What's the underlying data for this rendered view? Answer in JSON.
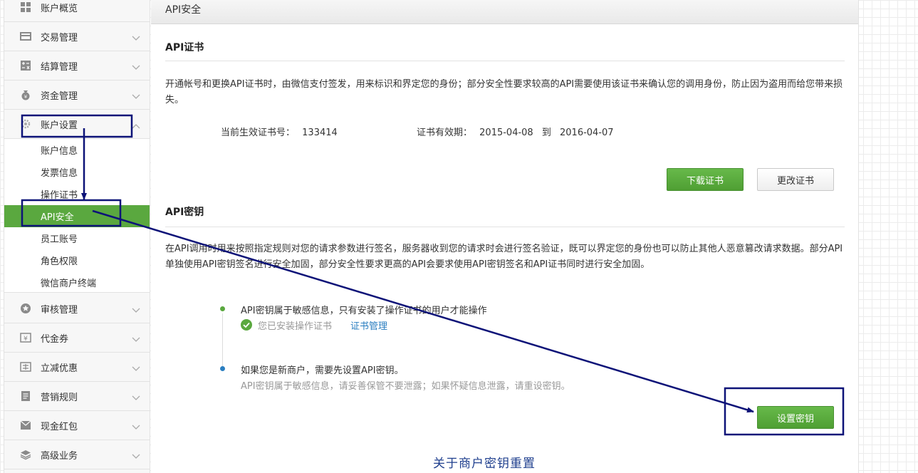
{
  "sidebar": {
    "items": [
      {
        "label": "账户概览",
        "icon": "grid-icon"
      },
      {
        "label": "交易管理",
        "icon": "card-icon"
      },
      {
        "label": "结算管理",
        "icon": "calculator-icon"
      },
      {
        "label": "资金管理",
        "icon": "money-bag-icon"
      },
      {
        "label": "账户设置",
        "icon": "gear-icon"
      },
      {
        "label": "审核管理",
        "icon": "star-badge-icon"
      },
      {
        "label": "代金券",
        "icon": "yen-icon"
      },
      {
        "label": "立减优惠",
        "icon": "discount-icon"
      },
      {
        "label": "营销规则",
        "icon": "document-icon"
      },
      {
        "label": "现金红包",
        "icon": "red-packet-icon"
      },
      {
        "label": "高级业务",
        "icon": "layers-icon"
      }
    ],
    "account_settings_subitems": [
      {
        "label": "账户信息"
      },
      {
        "label": "发票信息"
      },
      {
        "label": "操作证书"
      },
      {
        "label": "API安全"
      },
      {
        "label": "员工账号"
      },
      {
        "label": "角色权限"
      },
      {
        "label": "微信商户终端"
      }
    ]
  },
  "main": {
    "page_title": "API安全",
    "cert_section": {
      "title": "API证书",
      "description": "开通帐号和更换API证书时，由微信支付签发，用来标识和界定您的身份；部分安全性要求较高的API需要使用该证书来确认您的调用身份，防止因为盗用而给您带来损失。",
      "cert_number_label": "当前生效证书号：",
      "cert_number": "133414",
      "validity_label": "证书有效期：",
      "validity_start": "2015-04-08",
      "validity_to": "到",
      "validity_end": "2016-04-07",
      "download_button": "下载证书",
      "change_button": "更改证书"
    },
    "key_section": {
      "title": "API密钥",
      "description": "在API调用时用来按照指定规则对您的请求参数进行签名，服务器收到您的请求时会进行签名验证，既可以界定您的身份也可以防止其他人恶意篡改请求数据。部分API单独使用API密钥签名进行安全加固，部分安全性要求更高的API会要求使用API密钥签名和API证书同时进行安全加固。",
      "step1_text": "API密钥属于敏感信息，只有安装了操作证书的用户才能操作",
      "step1_status": "您已安装操作证书",
      "step1_link": "证书管理",
      "step2_text": "如果您是新商户，需要先设置API密钥。",
      "step2_note": "API密钥属于敏感信息，请妥善保管不要泄露；如果怀疑信息泄露，请重设密钥。",
      "set_key_button": "设置密钥"
    },
    "bottom_link": "关于商户密钥重置"
  },
  "colors": {
    "accent_green": "#5aa83f",
    "annotation_blue": "#0d1378",
    "link_blue": "#2a7ec0"
  }
}
